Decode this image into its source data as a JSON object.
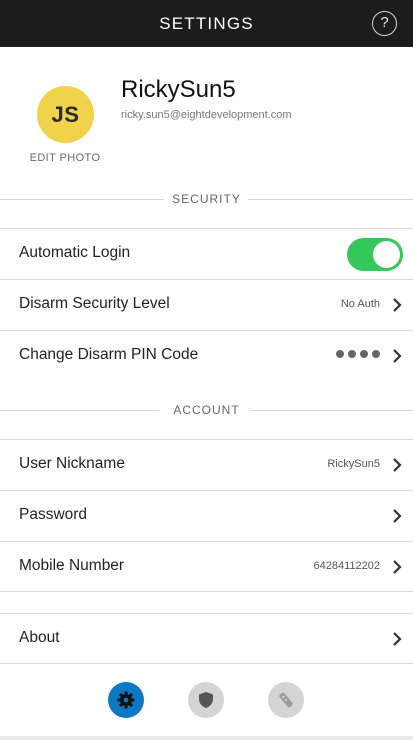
{
  "header": {
    "title": "SETTINGS",
    "help_label": "?",
    "help_icon": "question-icon"
  },
  "profile": {
    "initials": "JS",
    "avatar_color": "#f1d24b",
    "edit_photo": "EDIT PHOTO",
    "username": "RickySun5",
    "email": "ricky.sun5@eightdevelopment.com"
  },
  "security": {
    "title": "SECURITY",
    "automatic_login": {
      "label": "Automatic Login",
      "enabled": true
    },
    "disarm_level": {
      "label": "Disarm Security Level",
      "value": "No Auth"
    },
    "disarm_pin": {
      "label": "Change Disarm PIN Code",
      "masked_digits": 4
    }
  },
  "account": {
    "title": "ACCOUNT",
    "nickname": {
      "label": "User Nickname",
      "value": "RickySun5"
    },
    "password": {
      "label": "Password"
    },
    "mobile": {
      "label": "Mobile Number",
      "value": "64284112202"
    }
  },
  "about": {
    "label": "About"
  },
  "tabbar": {
    "items": [
      {
        "icon": "gear-icon",
        "active": true
      },
      {
        "icon": "shield-icon",
        "active": false
      },
      {
        "icon": "remote-icon",
        "active": false
      }
    ]
  },
  "colors": {
    "accent": "#0d79c4",
    "toggle_on": "#34c759",
    "header_bg": "#1c1c1c"
  }
}
